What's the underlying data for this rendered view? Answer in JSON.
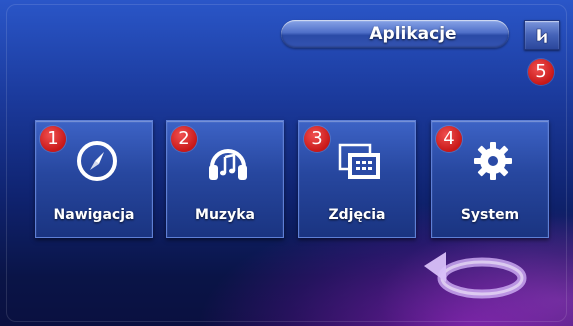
{
  "title_bar": {
    "title": "Aplikacje"
  },
  "power_button": {
    "icon": "power-icon",
    "badge": "5"
  },
  "tiles": [
    {
      "label": "Nawigacja",
      "icon": "compass-icon",
      "badge": "1"
    },
    {
      "label": "Muzyka",
      "icon": "headphones-icon",
      "badge": "2"
    },
    {
      "label": "Zdjęcia",
      "icon": "photos-icon",
      "badge": "3"
    },
    {
      "label": "System",
      "icon": "gear-icon",
      "badge": "4"
    }
  ],
  "back_button": {
    "icon": "back-arrow-icon"
  },
  "colors": {
    "badge": "#d42020",
    "tile": "#2a4aa6",
    "accent_purple": "#b020e0"
  }
}
